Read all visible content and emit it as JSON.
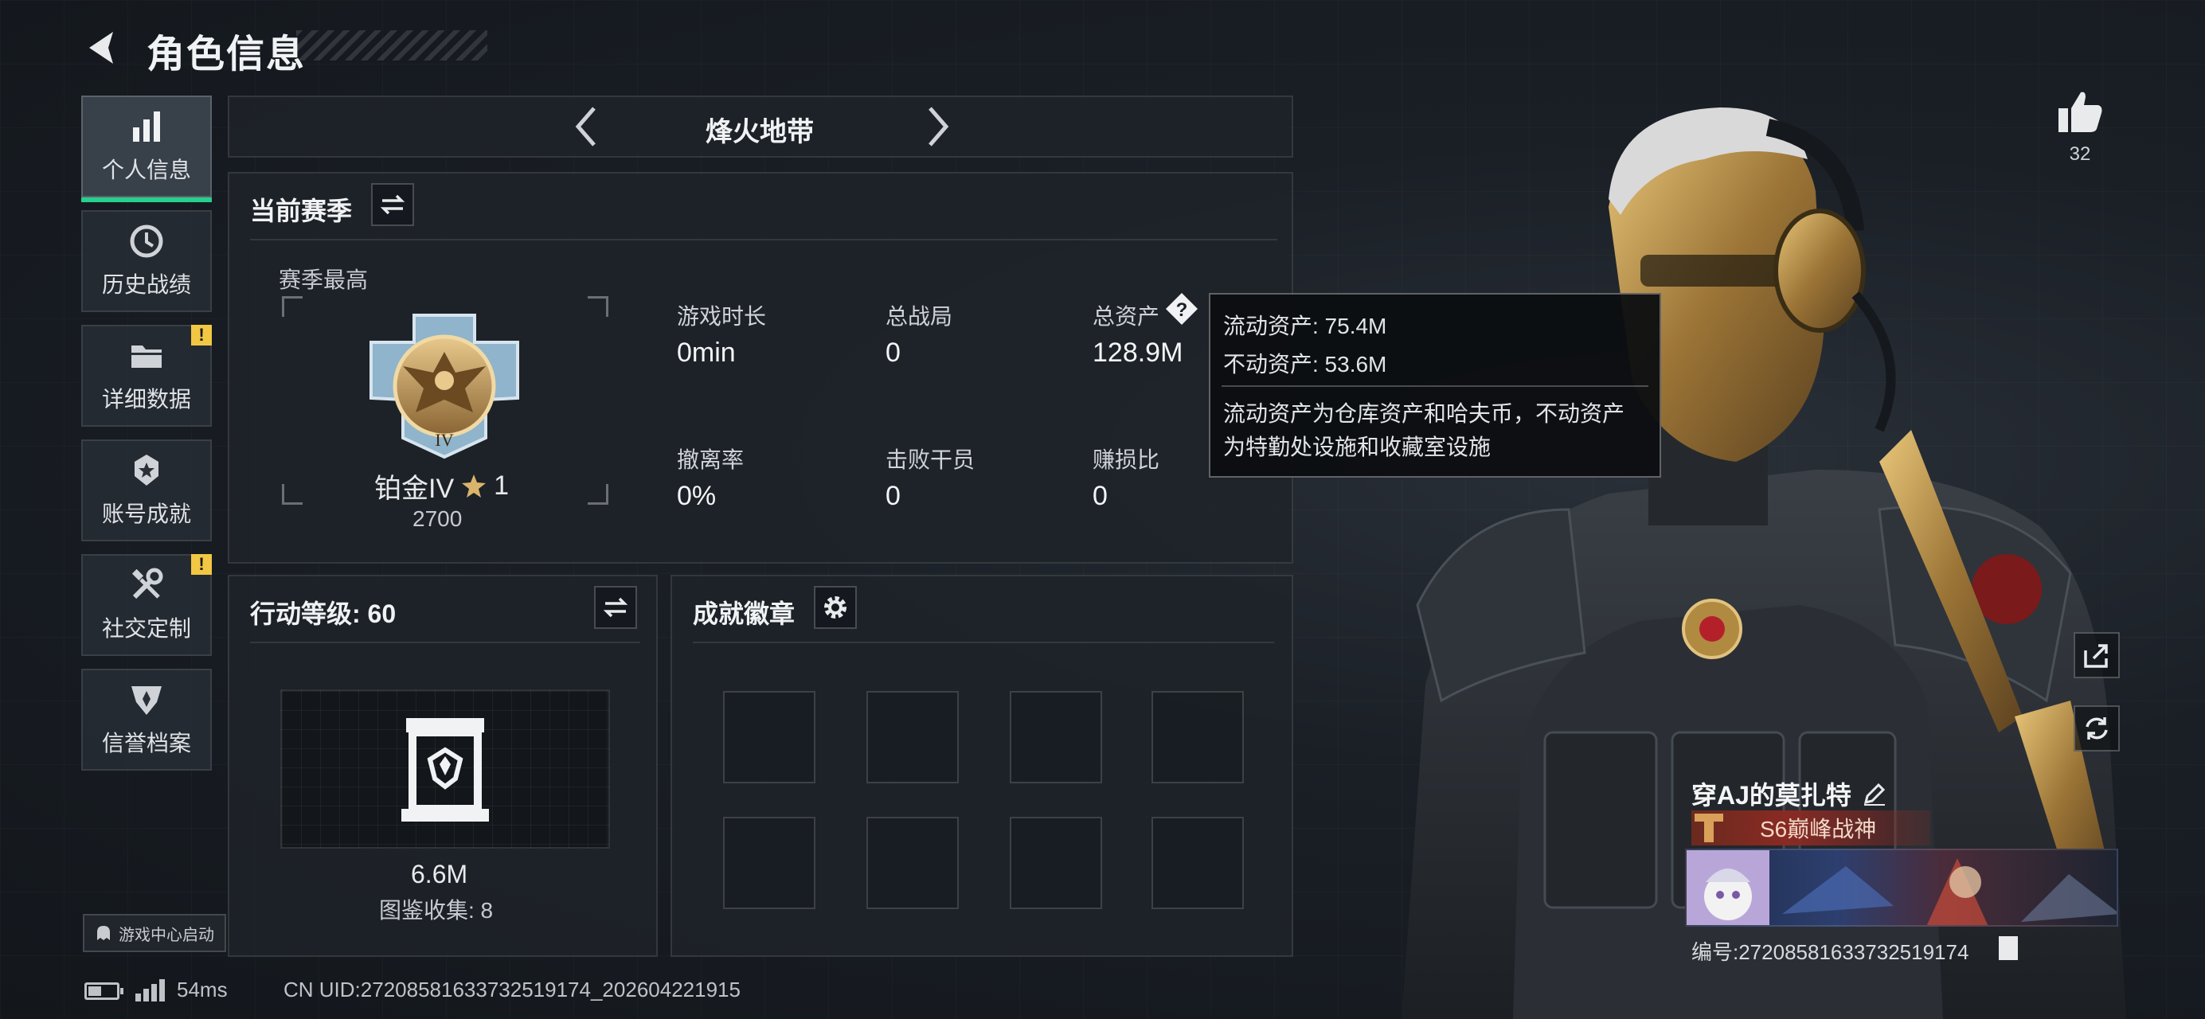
{
  "header": {
    "title": "角色信息"
  },
  "sidebar": {
    "items": [
      {
        "label": "个人信息",
        "icon": "bar-chart-icon",
        "active": true,
        "alert": false
      },
      {
        "label": "历史战绩",
        "icon": "history-clock-icon",
        "active": false,
        "alert": false
      },
      {
        "label": "详细数据",
        "icon": "folder-icon",
        "active": false,
        "alert": true
      },
      {
        "label": "账号成就",
        "icon": "achievement-medal-icon",
        "active": false,
        "alert": false
      },
      {
        "label": "社交定制",
        "icon": "tools-icon",
        "active": false,
        "alert": true
      },
      {
        "label": "信誉档案",
        "icon": "credit-shield-icon",
        "active": false,
        "alert": false
      }
    ],
    "alert_mark": "!",
    "game_center": "游戏中心启动"
  },
  "mode_selector": {
    "label": "烽火地带"
  },
  "season_panel": {
    "title": "当前赛季",
    "best_label": "赛季最高",
    "rank_name": "铂金IV",
    "rank_stars": "1",
    "rank_score": "2700",
    "rank_badge_numeral": "IV",
    "stats": [
      {
        "label": "游戏时长",
        "value": "0min"
      },
      {
        "label": "总战局",
        "value": "0"
      },
      {
        "label": "总资产",
        "value": "128.9M"
      },
      {
        "label": "撤离率",
        "value": "0%"
      },
      {
        "label": "击败干员",
        "value": "0"
      },
      {
        "label": "赚损比",
        "value": "0"
      }
    ]
  },
  "asset_tooltip": {
    "liquid": "流动资产: 75.4M",
    "fixed": "不动资产: 53.6M",
    "note_line1": "流动资产为仓库资产和哈夫币，不动资产",
    "note_line2": "为特勤处设施和收藏室设施"
  },
  "action_panel": {
    "title": "行动等级: 60",
    "value": "6.6M",
    "collection": "图鉴收集: 8"
  },
  "badges_panel": {
    "title": "成就徽章",
    "slot_count": 8
  },
  "likes": {
    "count": "32"
  },
  "player": {
    "name": "穿AJ的莫扎特",
    "title_badge": "S6巅峰战神",
    "id_line": "编号:2720858163373251917​4"
  },
  "footer": {
    "ping": "54ms",
    "uid": "CN UID:2720858163373251917​4_202604221915"
  },
  "colors": {
    "accent_green": "#25d08e",
    "warning_yellow": "#f2c744",
    "title_badge_red": "#8a2a24",
    "gold": "#c89a48"
  }
}
